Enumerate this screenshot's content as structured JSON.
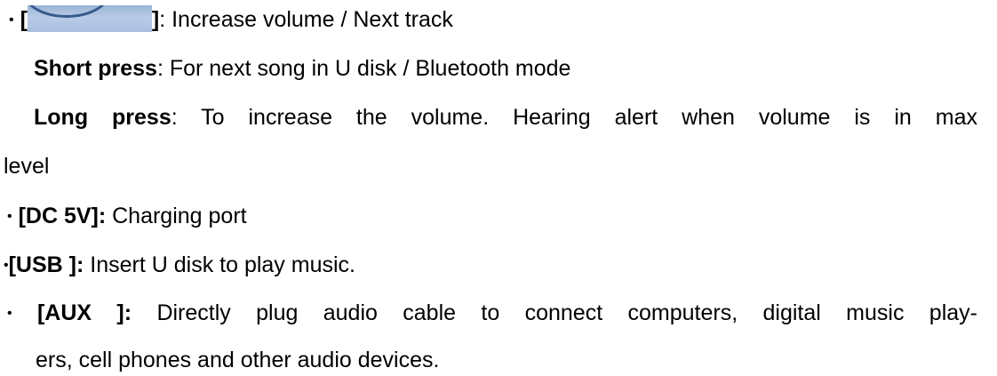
{
  "items": [
    {
      "label": "]",
      "text": ": Increase volume / Next track",
      "details": [
        {
          "term": "Short press",
          "text": ": For next song in U disk / Bluetooth mode"
        },
        {
          "term": "Long press",
          "text": ": To increase the volume. Hearing alert when volume is in max",
          "continuation": "level"
        }
      ]
    },
    {
      "label": "[DC 5V]:",
      "text": " Charging port"
    },
    {
      "label": "[USB ]:",
      "text": " Insert U disk to play music."
    },
    {
      "label": "[AUX ]:",
      "text": " Directly plug audio cable to connect computers, digital music play-",
      "continuation": "ers, cell phones and other audio devices."
    }
  ],
  "bullet_char": "•",
  "open_bracket": "["
}
